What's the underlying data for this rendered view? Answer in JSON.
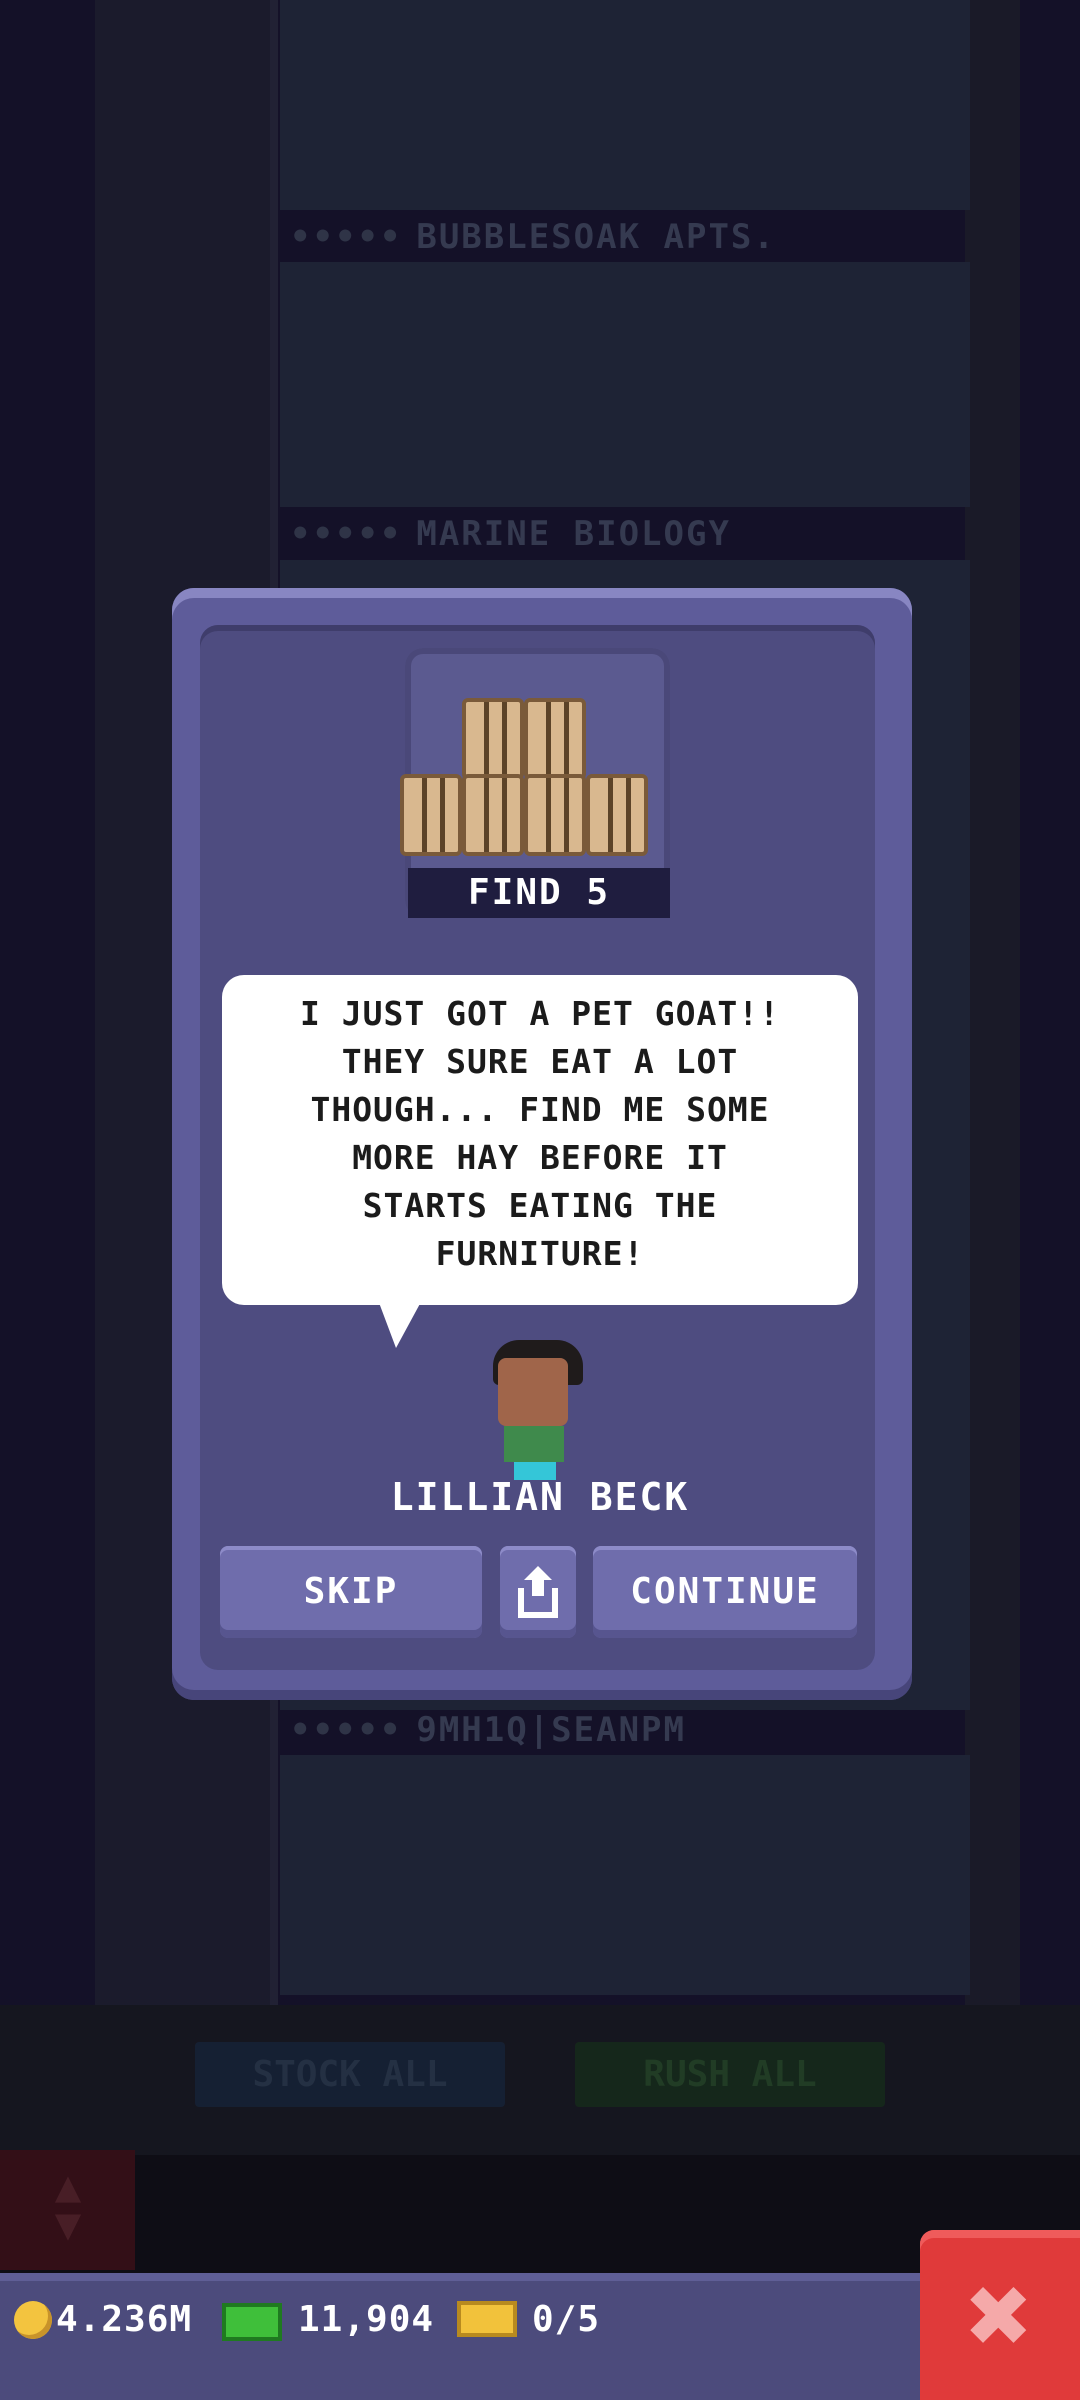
{
  "background": {
    "floors": [
      {
        "label": "BUBBLESOAK APTS.",
        "dots": "•••••"
      },
      {
        "label": "MARINE BIOLOGY",
        "dots": "•••••"
      },
      {
        "label": "9MH1Q|SEANPM",
        "dots": "•••••"
      }
    ],
    "stock_all_label": "STOCK ALL",
    "rush_all_label": "RUSH ALL"
  },
  "dialog": {
    "task_label": "FIND 5",
    "message": "I JUST GOT A PET GOAT!!\nTHEY SURE EAT A LOT\nTHOUGH... FIND ME SOME\nMORE HAY BEFORE IT\nSTARTS EATING THE\nFURNITURE!",
    "character_name": "LILLIAN BECK",
    "skip_label": "SKIP",
    "continue_label": "CONTINUE"
  },
  "status": {
    "coins": "4.236M",
    "bux": "11,904",
    "tickets": "0/5"
  },
  "colors": {
    "dialog_frame": "#5e5c9a",
    "dialog_inner": "#4e4c80",
    "button": "#6f6dac",
    "close": "#e03a3a"
  }
}
